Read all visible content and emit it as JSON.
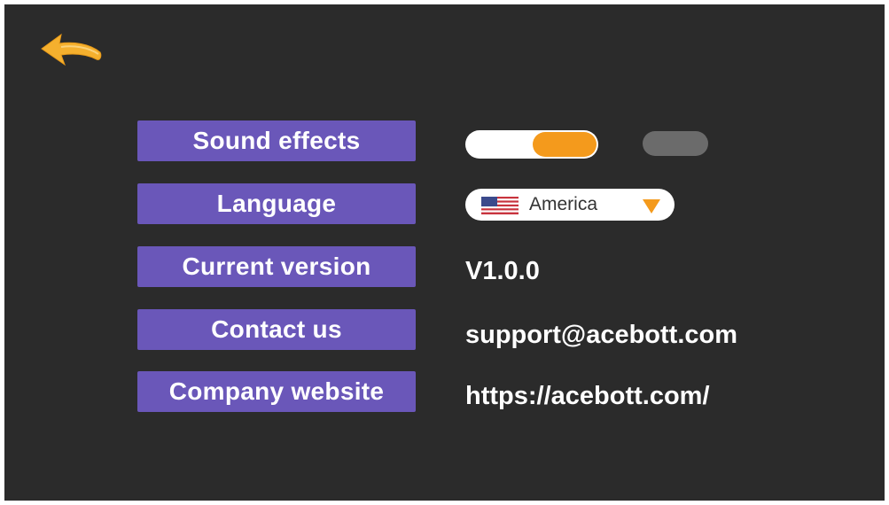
{
  "colors": {
    "background": "#2b2b2b",
    "label_fill": "#6a57b9",
    "accent": "#f49a1c",
    "toggle_off": "#6b6b6b"
  },
  "back_button": {
    "icon": "back-arrow-icon"
  },
  "settings": {
    "sound_effects": {
      "label": "Sound effects",
      "state": "on"
    },
    "language": {
      "label": "Language",
      "selected": "America",
      "flag_icon": "us-flag-icon"
    },
    "current_version": {
      "label": "Current version",
      "value": "V1.0.0"
    },
    "contact_us": {
      "label": "Contact us",
      "value": "support@acebott.com"
    },
    "company_website": {
      "label": "Company website",
      "value": "https://acebott.com/"
    }
  }
}
